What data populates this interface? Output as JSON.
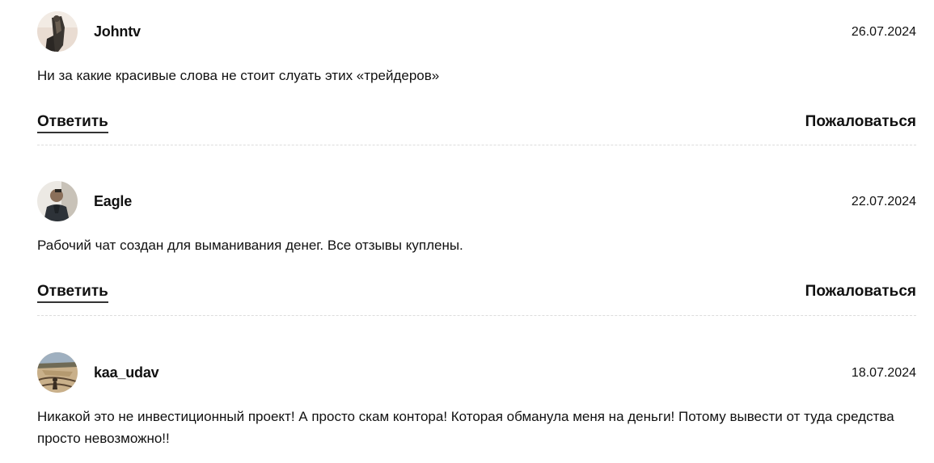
{
  "comments": [
    {
      "author": "Johntv",
      "date": "26.07.2024",
      "text": "Ни за какие красивые слова не стоит слуать этих «трейдеров»",
      "reply_label": "Ответить",
      "report_label": "Пожаловаться",
      "avatar_icon": "user-photo-avatar"
    },
    {
      "author": "Eagle",
      "date": "22.07.2024",
      "text": "Рабочий чат создан для выманивания денег. Все отзывы куплены.",
      "reply_label": "Ответить",
      "report_label": "Пожаловаться",
      "avatar_icon": "user-photo-avatar"
    },
    {
      "author": "kaa_udav",
      "date": "18.07.2024",
      "text": "Никакой это не инвестиционный проект! А просто скам контора! Которая обманула меня на деньги! Потому вывести от туда средства просто невозможно!!",
      "avatar_icon": "user-photo-avatar"
    }
  ]
}
